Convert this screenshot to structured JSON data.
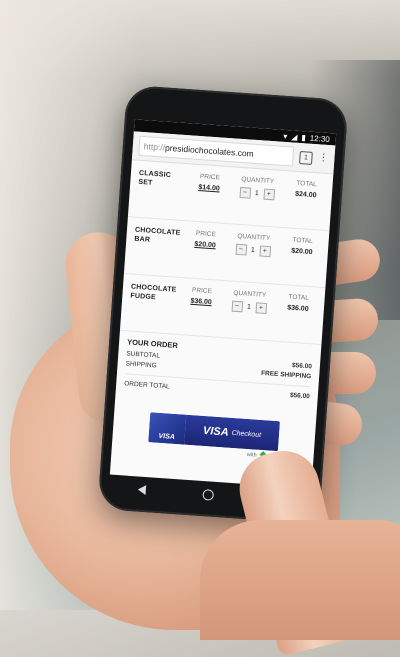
{
  "status_bar": {
    "time": "12:30",
    "icons": [
      "wifi-icon",
      "signal-icon",
      "battery-icon"
    ]
  },
  "browser": {
    "url_protocol": "http://",
    "url_host": "presidiochocolates.com",
    "tab_count": "1"
  },
  "cart": {
    "labels": {
      "price": "PRICE",
      "quantity": "QUANTITY",
      "total": "TOTAL"
    },
    "items": [
      {
        "name_line1": "CLASSIC",
        "name_line2": "SET",
        "price": "$14.00",
        "quantity": "1",
        "total": "$24.00"
      },
      {
        "name_line1": "CHOCOLATE",
        "name_line2": "BAR",
        "price": "$20.00",
        "quantity": "1",
        "total": "$20.00"
      },
      {
        "name_line1": "CHOCOLATE",
        "name_line2": "FUDGE",
        "price": "$36.00",
        "quantity": "1",
        "total": "$36.00"
      }
    ]
  },
  "order": {
    "heading": "YOUR ORDER",
    "subtotal_label": "SUBTOTAL",
    "subtotal_value": "$56.00",
    "shipping_label": "SHIPPING",
    "shipping_value": "FREE SHIPPING",
    "total_label": "ORDER TOTAL",
    "total_value": "$56.00"
  },
  "checkout": {
    "card_text": "VISA",
    "brand": "VISA",
    "button_text": "Checkout",
    "footer_with": "with",
    "footer_pay": "pay"
  },
  "colors": {
    "visa_blue": "#1c2575",
    "pay_green": "#39a947"
  }
}
